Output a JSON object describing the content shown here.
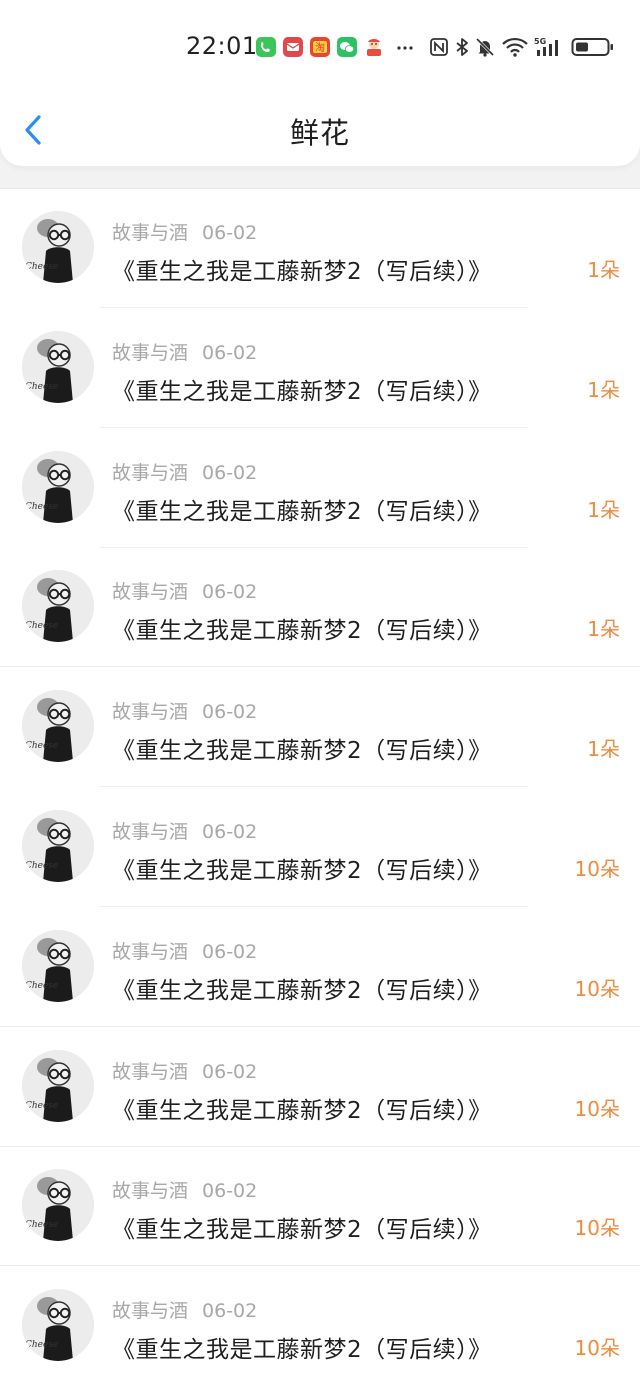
{
  "status_bar": {
    "time": "22:01",
    "network": "5G",
    "icons": [
      "phone-app-icon",
      "mail-app-icon",
      "taobao-app-icon",
      "wechat-app-icon",
      "game-app-icon",
      "more-icon",
      "nfc-icon",
      "bluetooth-icon",
      "mute-icon",
      "wifi-icon",
      "signal-icon",
      "battery-icon"
    ]
  },
  "header": {
    "back_icon": "chevron-left-icon",
    "title": "鲜花"
  },
  "colors": {
    "accent_blue": "#2b8ef0",
    "count_orange": "#f08a3c",
    "meta_gray": "#a8a8a8"
  },
  "items": [
    {
      "user": "故事与酒",
      "date": "06-02",
      "title": "《重生之我是工藤新梦2（写后续）》",
      "count": "1朵"
    },
    {
      "user": "故事与酒",
      "date": "06-02",
      "title": "《重生之我是工藤新梦2（写后续）》",
      "count": "1朵"
    },
    {
      "user": "故事与酒",
      "date": "06-02",
      "title": "《重生之我是工藤新梦2（写后续）》",
      "count": "1朵"
    },
    {
      "user": "故事与酒",
      "date": "06-02",
      "title": "《重生之我是工藤新梦2（写后续）》",
      "count": "1朵"
    },
    {
      "user": "故事与酒",
      "date": "06-02",
      "title": "《重生之我是工藤新梦2（写后续）》",
      "count": "1朵"
    },
    {
      "user": "故事与酒",
      "date": "06-02",
      "title": "《重生之我是工藤新梦2（写后续）》",
      "count": "10朵"
    },
    {
      "user": "故事与酒",
      "date": "06-02",
      "title": "《重生之我是工藤新梦2（写后续）》",
      "count": "10朵"
    },
    {
      "user": "故事与酒",
      "date": "06-02",
      "title": "《重生之我是工藤新梦2（写后续）》",
      "count": "10朵"
    },
    {
      "user": "故事与酒",
      "date": "06-02",
      "title": "《重生之我是工藤新梦2（写后续）》",
      "count": "10朵"
    },
    {
      "user": "故事与酒",
      "date": "06-02",
      "title": "《重生之我是工藤新梦2（写后续）》",
      "count": "10朵"
    }
  ]
}
